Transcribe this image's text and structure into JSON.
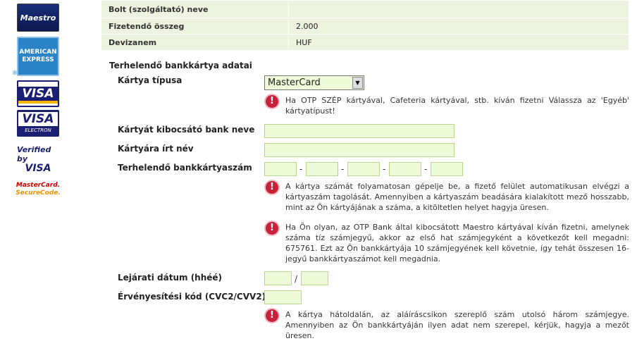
{
  "logos": {
    "maestro": "Maestro",
    "amex_line1": "AMERICAN",
    "amex_line2": "EXPRESS",
    "amex_reg": "®",
    "visa": "VISA",
    "visa_electron_top": "VISA",
    "visa_electron_bottom": "ELECTRON",
    "vbv_line1": "Verified by",
    "vbv_line2": "VISA",
    "msc_line1": "MasterCard.",
    "msc_line2": "SecureCode."
  },
  "summary": {
    "rows": [
      {
        "label": "Bolt (szolgáltató) neve",
        "value": ""
      },
      {
        "label": "Fizetendő összeg",
        "value": "2.000"
      },
      {
        "label": "Devizanem",
        "value": "HUF"
      }
    ]
  },
  "form": {
    "section_title": "Terhelendő bankkártya adatai",
    "card_type_label": "Kártya típusa",
    "card_type_value": "MasterCard",
    "card_type_note": "Ha OTP SZÉP kártyával, Cafeteria kártyával, stb. kíván fizetni Válassza az 'Egyéb' kártyatípust!",
    "bank_label": "Kártyát kibocsátó bank neve",
    "name_label": "Kártyára írt név",
    "number_label": "Terhelendő bankkártyaszám",
    "separator": "-",
    "number_note1": "A kártya számát folyamatosan gépelje be, a fizető felület automatikusan elvégzi a kártyaszám tagolását. Amennyiben a kártyaszám beadására kialakított mező hosszabb, mint az Ön kártyájának a száma, a kitöltetlen helyet hagyja üresen.",
    "number_note2": "Ha Ön olyan, az OTP Bank által kibocsátott Maestro kártyával kíván fizetni, amelynek száma tíz számjegyű, akkor az első hat számjegyként a következőt kell megadni: 675761. Ezt az Ön bankkártyája 10 számjegyének kell követnie, így tehát összesen 16-jegyű bankkártyaszámot kell megadnia.",
    "expiry_label": "Lejárati dátum (hhéé)",
    "expiry_separator": "/",
    "cvc_label": "Érvényesítési kód (CVC2/CVV2)",
    "cvc_note": "A kártya hátoldalán, az aláíráscsíkon szereplő szám utolsó három számjegye. Amennyiben az Ön bankkártyáján ilyen adat nem szerepel, kérjük, hagyja a mezőt üresen."
  },
  "icons": {
    "warning": "!",
    "select_arrow": "▼"
  }
}
